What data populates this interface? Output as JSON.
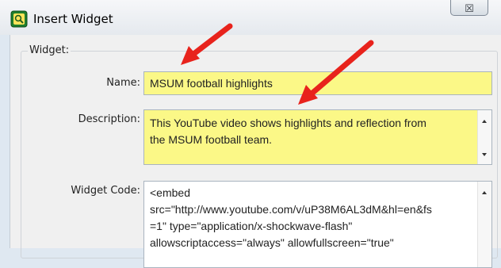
{
  "window": {
    "title": "Insert Widget",
    "close_glyph": "☒"
  },
  "group": {
    "label": "Widget:"
  },
  "form": {
    "name": {
      "label": "Name:",
      "value": "MSUM football highlights"
    },
    "description": {
      "label": "Description:",
      "lines": [
        "This YouTube video shows highlights and reflection from",
        "the MSUM football team."
      ]
    },
    "widget_code": {
      "label": "Widget Code:",
      "lines": [
        "<embed",
        "src=\"http://www.youtube.com/v/uP38M6AL3dM&hl=en&fs",
        "=1\" type=\"application/x-shockwave-flash\"",
        "allowscriptaccess=\"always\" allowfullscreen=\"true\""
      ]
    }
  },
  "colors": {
    "highlight": "#fbf887",
    "annotation_arrow": "#e8231c"
  },
  "icons": {
    "app": "widget-app-icon",
    "close": "close-icon",
    "annotation": "red-arrow-icon"
  }
}
